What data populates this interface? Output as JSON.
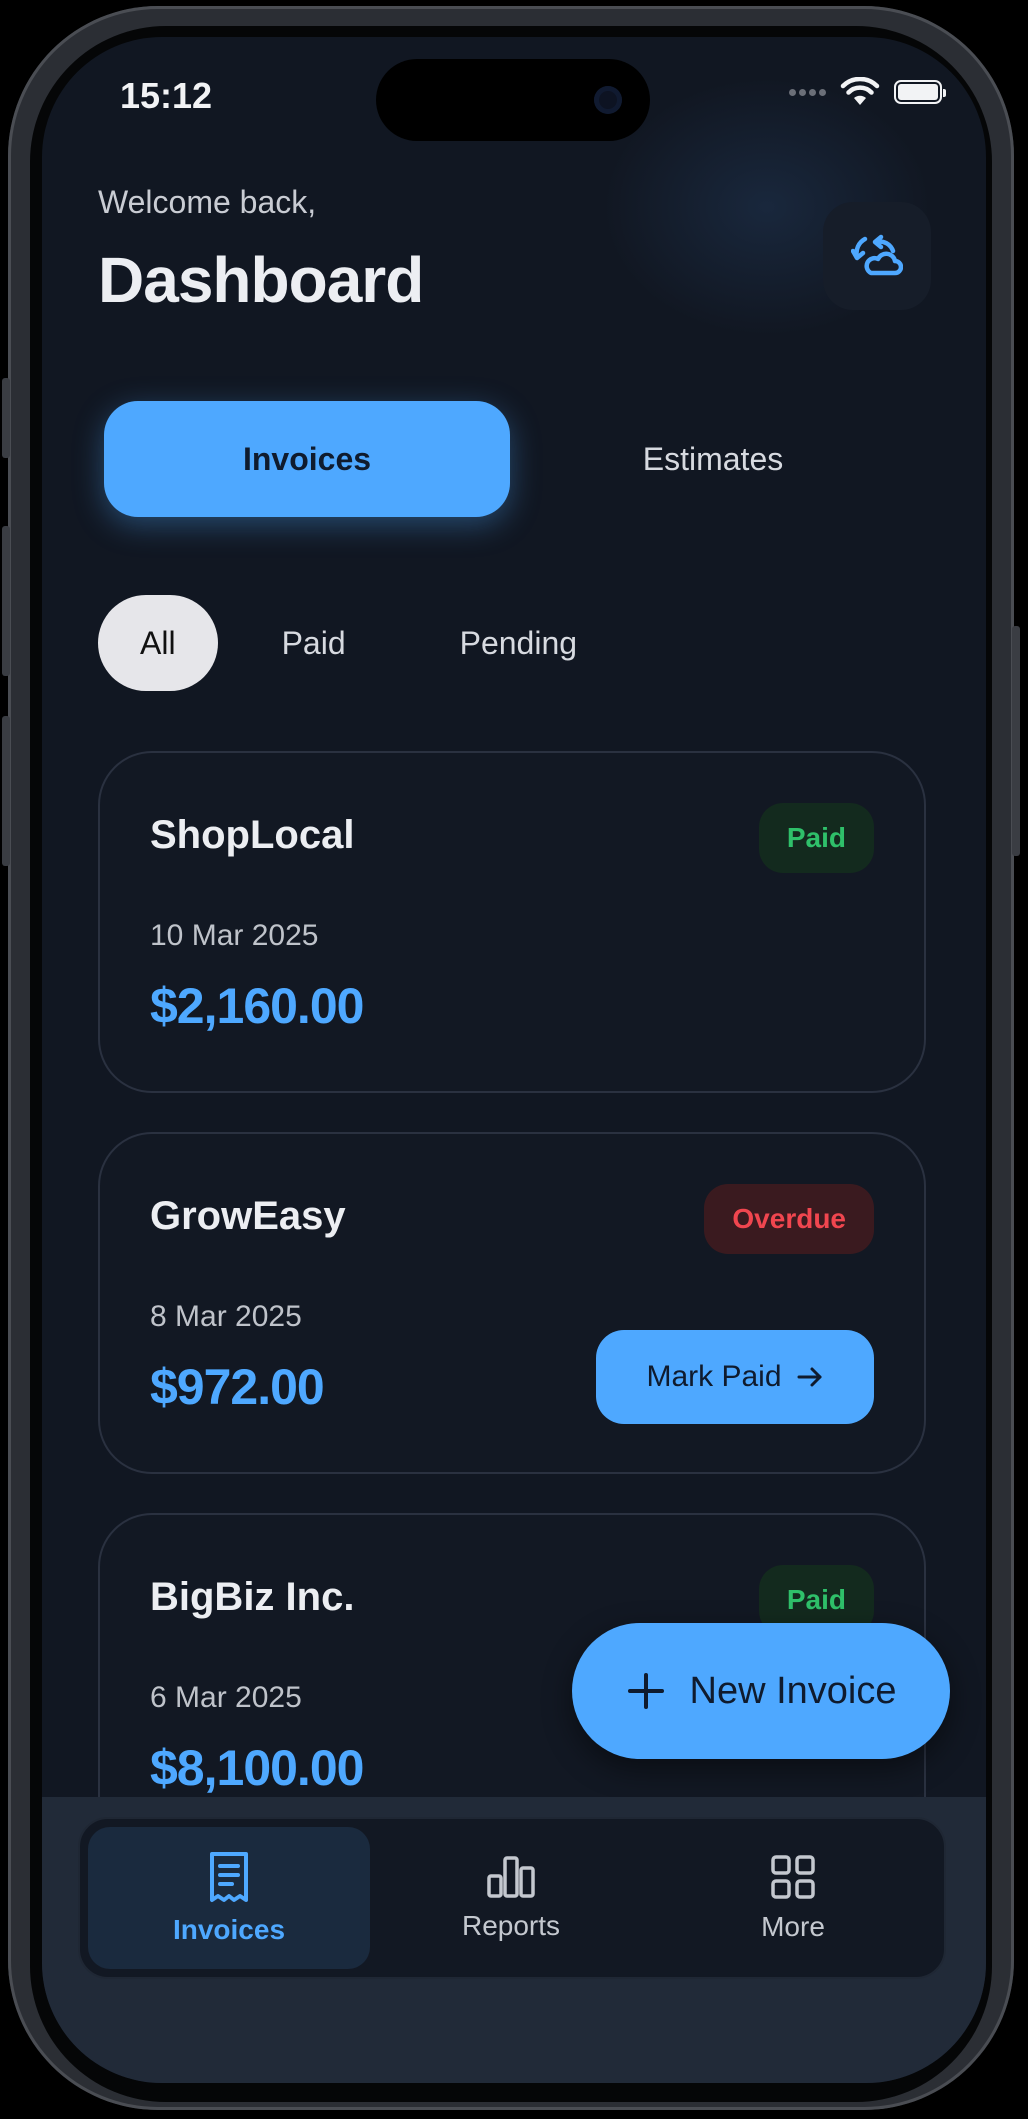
{
  "status": {
    "time": "15:12"
  },
  "header": {
    "welcome": "Welcome back,",
    "title": "Dashboard"
  },
  "tabs": [
    {
      "label": "Invoices",
      "active": true
    },
    {
      "label": "Estimates",
      "active": false
    }
  ],
  "filters": [
    {
      "label": "All",
      "active": true
    },
    {
      "label": "Paid",
      "active": false
    },
    {
      "label": "Pending",
      "active": false
    }
  ],
  "invoices": [
    {
      "client": "ShopLocal",
      "date": "10 Mar 2025",
      "amount": "$2,160.00",
      "status": "Paid"
    },
    {
      "client": "GrowEasy",
      "date": "8 Mar 2025",
      "amount": "$972.00",
      "status": "Overdue",
      "action": "Mark Paid"
    },
    {
      "client": "BigBiz Inc.",
      "date": "6 Mar 2025",
      "amount": "$8,100.00",
      "status": "Paid"
    }
  ],
  "fab": {
    "label": "New Invoice",
    "icon": "plus-icon"
  },
  "nav": [
    {
      "label": "Invoices",
      "icon": "receipt-icon",
      "active": true
    },
    {
      "label": "Reports",
      "icon": "bar-chart-icon",
      "active": false
    },
    {
      "label": "More",
      "icon": "grid-icon",
      "active": false
    }
  ],
  "colors": {
    "accent": "#4ea8ff",
    "background": "#111722",
    "paid": "#2fc06a",
    "overdue": "#f0464f"
  }
}
